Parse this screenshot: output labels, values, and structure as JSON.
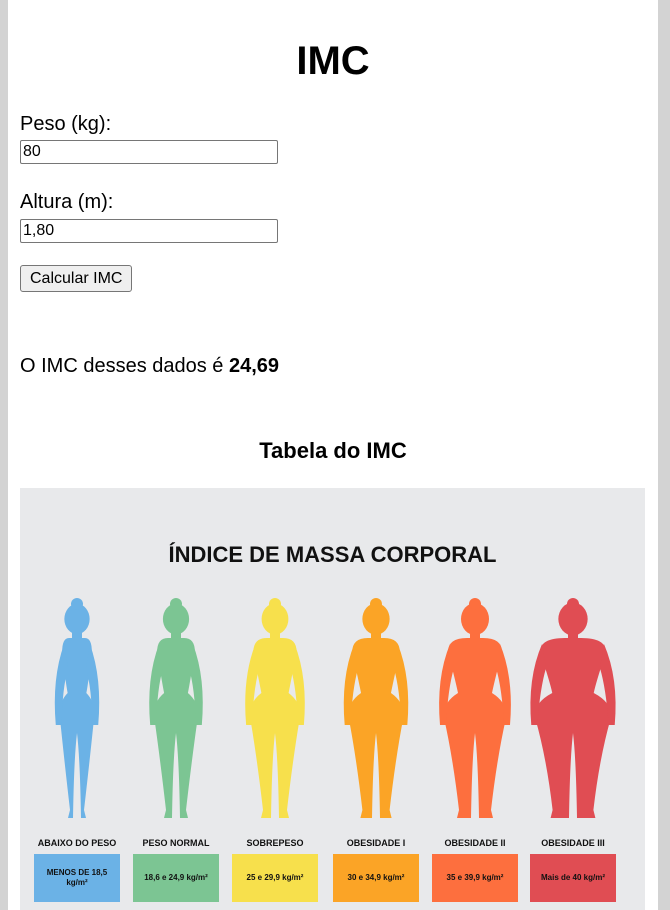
{
  "header": {
    "title": "IMC"
  },
  "form": {
    "weight_label": "Peso (kg):",
    "weight_value": "80",
    "height_label": "Altura (m):",
    "height_value": "1,80",
    "calculate_label": "Calcular IMC"
  },
  "result": {
    "prefix": "O IMC desses dados é ",
    "value": "24,69"
  },
  "table": {
    "heading": "Tabela do IMC",
    "image_title": "ÍNDICE DE MASSA CORPORAL",
    "categories": [
      {
        "label": "ABAIXO DO PESO",
        "range": "MENOS DE 18,5 kg/m²",
        "color": "#6bb2e6"
      },
      {
        "label": "PESO NORMAL",
        "range": "18,6 e 24,9 kg/m²",
        "color": "#7cc593"
      },
      {
        "label": "SOBREPESO",
        "range": "25 e 29,9 kg/m²",
        "color": "#f7e04c"
      },
      {
        "label": "OBESIDADE I",
        "range": "30 e 34,9 kg/m²",
        "color": "#fba426"
      },
      {
        "label": "OBESIDADE II",
        "range": "35 e 39,9 kg/m²",
        "color": "#fd6f3e"
      },
      {
        "label": "OBESIDADE III",
        "range": "Mais de 40 kg/m²",
        "color": "#e04d53"
      }
    ]
  }
}
